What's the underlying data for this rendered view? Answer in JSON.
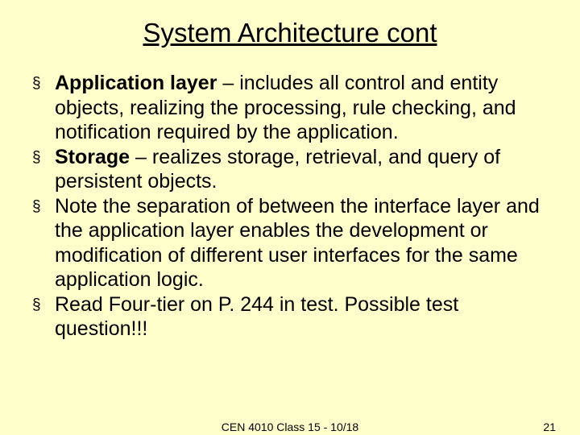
{
  "title": "System Architecture cont",
  "bullets": {
    "b0": {
      "lead": "Application layer",
      "rest": " – includes all control and entity objects, realizing the processing, rule checking, and notification required by the application."
    },
    "b1": {
      "lead": "Storage",
      "rest": " – realizes storage, retrieval, and query of persistent objects."
    },
    "b2": {
      "lead": "",
      "rest": "Note the separation of between the interface layer and the application layer enables the development or modification of different user interfaces for the same application logic."
    },
    "b3": {
      "lead": "",
      "rest": "Read Four-tier on P. 244 in test.  Possible test question!!!"
    }
  },
  "bullet_glyph": "§",
  "footer": {
    "center": "CEN 4010 Class 15 - 10/18",
    "page": "21"
  }
}
